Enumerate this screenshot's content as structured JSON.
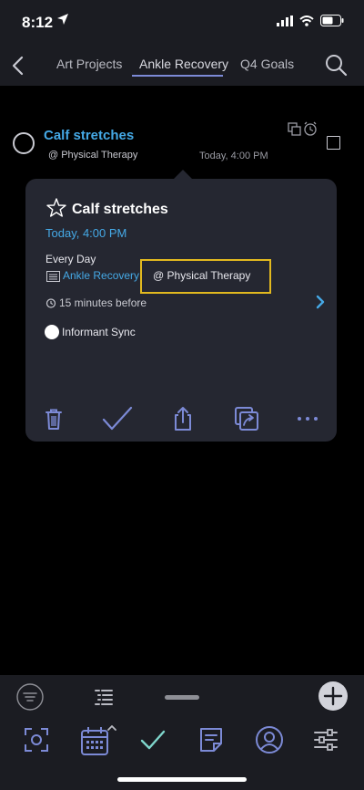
{
  "status_bar": {
    "time": "8:12"
  },
  "nav": {
    "tabs": [
      "Art Projects",
      "Ankle Recovery",
      "Q4 Goals"
    ],
    "active_tab": "Ankle Recovery"
  },
  "task": {
    "title": "Calf stretches",
    "context": "@ Physical Therapy",
    "date": "Today, 4:00 PM"
  },
  "popup": {
    "title": "Calf stretches",
    "date": "Today, 4:00 PM",
    "repeat": "Every Day",
    "folder": "Ankle Recovery",
    "context": "@ Physical Therapy",
    "alarm": "15 minutes before",
    "sync": "Informant Sync"
  },
  "colors": {
    "accent_blue": "#45a9e6",
    "icon_blue": "#7c8ad6",
    "complete_teal": "#7fd6cc",
    "highlight": "#e2b91f",
    "panel": "#252731",
    "bar": "#1b1c22"
  },
  "icons": {
    "back": "chevron-left-icon",
    "search": "search-icon",
    "star": "star-icon",
    "delete": "trash-icon",
    "complete": "check-icon",
    "share": "share-icon",
    "duplicate": "duplicate-icon",
    "more": "more-icon"
  }
}
